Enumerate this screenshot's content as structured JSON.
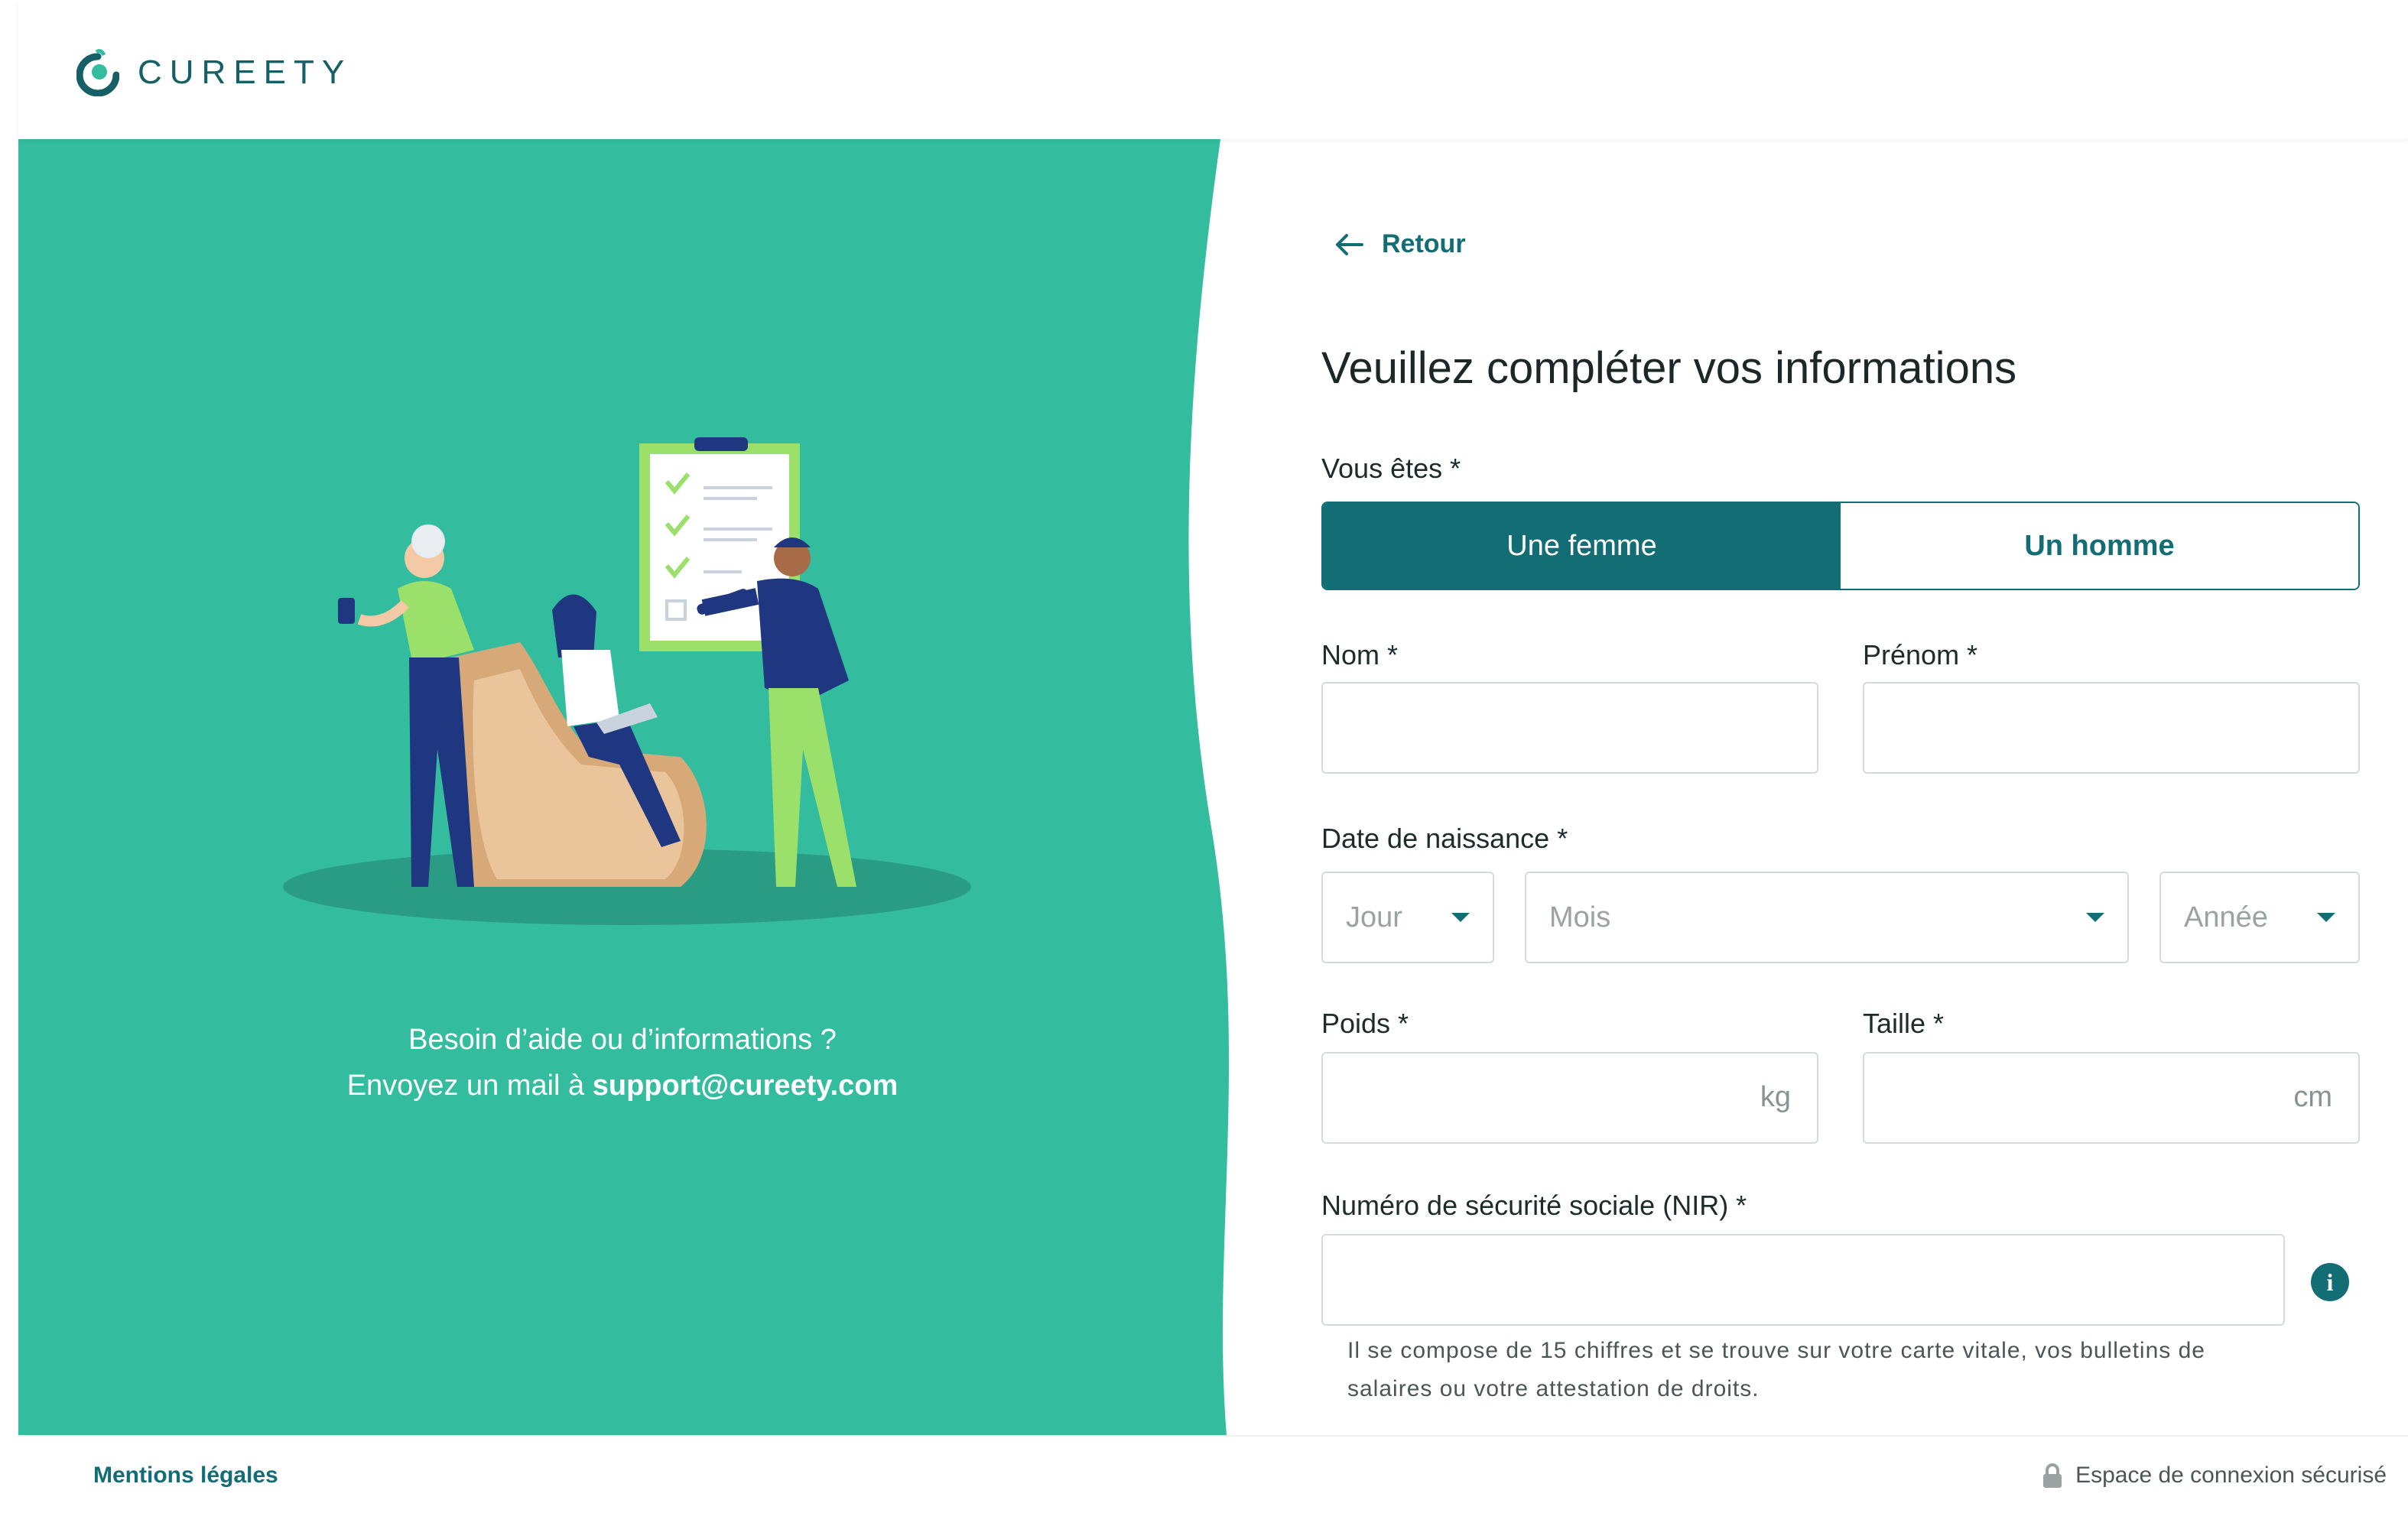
{
  "header": {
    "brand": "CUREETY"
  },
  "colors": {
    "accent": "#136d75",
    "panel": "#34bc9e",
    "light_green": "#9be06b",
    "navy": "#1f3780"
  },
  "help": {
    "line1": "Besoin d’aide ou d’informations ?",
    "line2_prefix": "Envoyez un mail à ",
    "email": "support@cureety.com"
  },
  "form": {
    "back_label": "Retour",
    "title": "Veuillez compléter vos informations",
    "gender_label": "Vous êtes *",
    "gender_options": [
      "Une femme",
      "Un homme"
    ],
    "gender_selected": "Une femme",
    "nom_label": "Nom *",
    "prenom_label": "Prénom *",
    "birth_label": "Date de naissance *",
    "jour_placeholder": "Jour",
    "mois_placeholder": "Mois",
    "annee_placeholder": "Année",
    "poids_label": "Poids *",
    "poids_unit": "kg",
    "taille_label": "Taille *",
    "taille_unit": "cm",
    "nir_label": "Numéro de sécurité sociale (NIR) *",
    "nir_hint": "Il se compose de 15 chiffres et se trouve sur votre carte vitale, vos bulletins de salaires ou votre attestation de droits."
  },
  "footer": {
    "legal": "Mentions légales",
    "secure": "Espace de connexion sécurisé"
  }
}
